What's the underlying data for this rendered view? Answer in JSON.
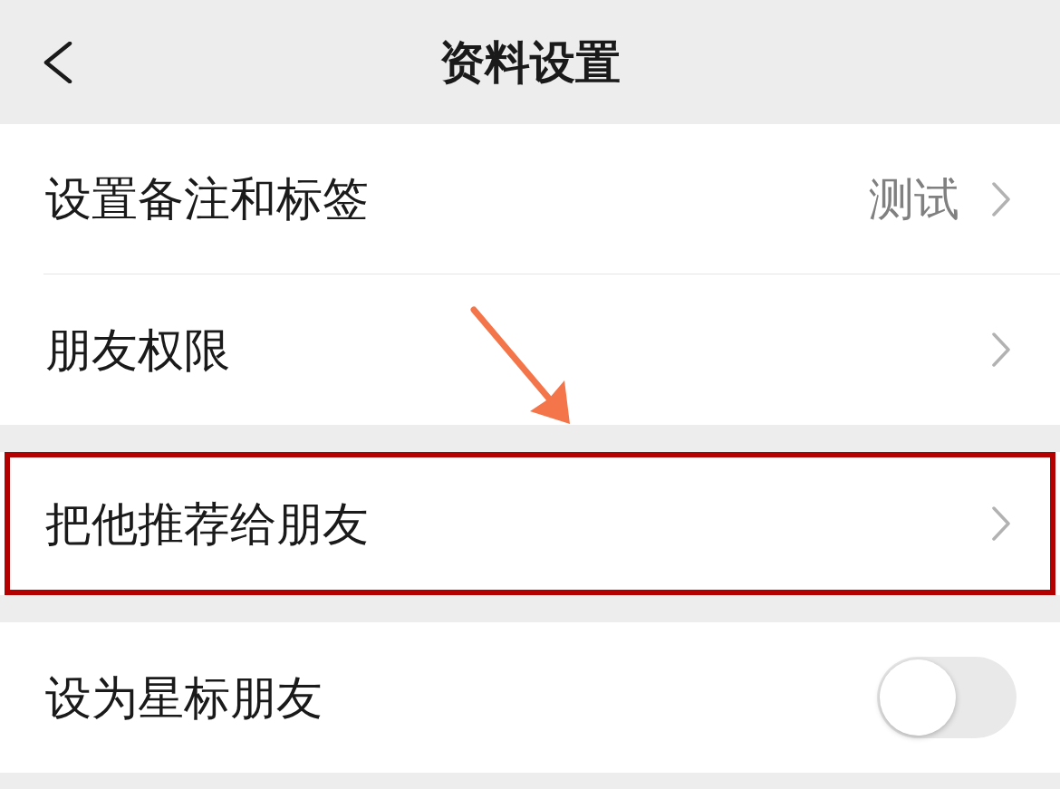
{
  "header": {
    "title": "资料设置"
  },
  "groups": [
    {
      "rows": [
        {
          "kind": "link",
          "label": "设置备注和标签",
          "value": "测试",
          "highlighted": false
        },
        {
          "kind": "link",
          "label": "朋友权限",
          "highlighted": false
        }
      ]
    },
    {
      "rows": [
        {
          "kind": "link",
          "label": "把他推荐给朋友",
          "highlighted": true
        }
      ]
    },
    {
      "rows": [
        {
          "kind": "toggle",
          "label": "设为星标朋友",
          "on": false,
          "highlighted": false
        }
      ]
    }
  ]
}
